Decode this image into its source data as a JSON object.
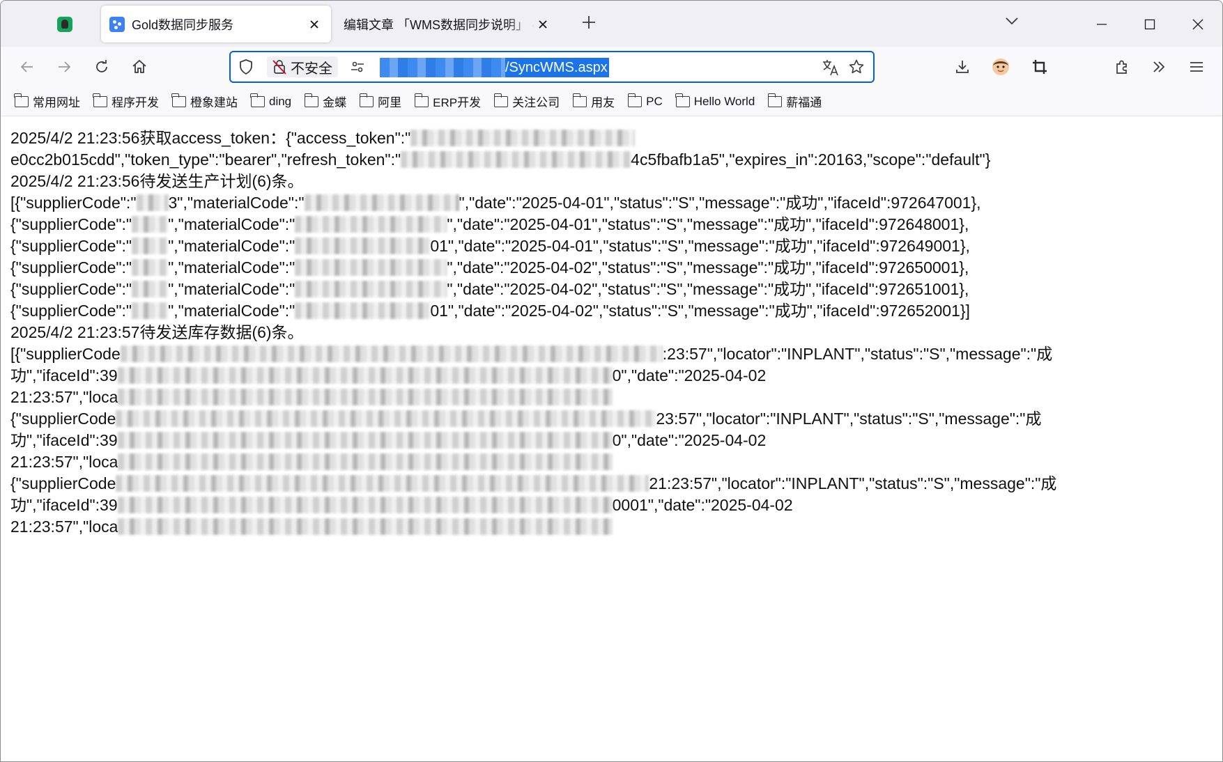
{
  "tabs": [
    {
      "title": "Gold数据同步服务",
      "active": true
    },
    {
      "title": "编辑文章 「WMS数据同步说明」 ‹ s",
      "active": false
    }
  ],
  "urlbar": {
    "security_label": "不安全",
    "url_path": "/SyncWMS.aspx"
  },
  "bookmarks": [
    "常用网址",
    "程序开发",
    "橙象建站",
    "ding",
    "金蝶",
    "阿里",
    "ERP开发",
    "关注公司",
    "用友",
    "PC",
    "Hello World",
    "薪福通"
  ],
  "icons": {
    "pinned_tab": "evernote-icon",
    "tab_favicon": "gold-favicon",
    "nav": [
      "back-icon",
      "forward-icon",
      "reload-icon",
      "home-icon"
    ],
    "urlbar": [
      "shield-icon",
      "insecure-lock-icon",
      "permissions-icon",
      "translate-icon",
      "bookmark-star-icon"
    ],
    "toolbar": [
      "download-icon",
      "profile-avatar-icon",
      "screenshot-crop-icon",
      "extensions-icon",
      "overflow-chevron-icon",
      "menu-icon"
    ],
    "window": [
      "minimize-icon",
      "maximize-icon",
      "close-icon"
    ]
  },
  "log": {
    "l1a": "2025/4/2 21:23:56获取access_token：{\"access_token\":\"",
    "l2a": "e0cc2b015cdd\",\"token_type\":\"bearer\",\"refresh_token\":\"",
    "l2b": "4c5fbafb1a5\",\"expires_in\":20163,\"scope\":\"default\"}",
    "l3": "2025/4/2 21:23:56待发送生产计划(6)条。",
    "l4a": "[{\"supplierCode\":\"",
    "l4b": "3\",\"materialCode\":\"",
    "l4c": "\",\"date\":\"2025-04-01\",\"status\":\"S\",\"message\":\"成功\",\"ifaceId\":972647001},",
    "l5a": "{\"supplierCode\":\"",
    "l5b": "\",\"materialCode\":\"",
    "l5c": "\",\"date\":\"2025-04-01\",\"status\":\"S\",\"message\":\"成功\",\"ifaceId\":972648001},",
    "l6a": "{\"supplierCode\":\"",
    "l6b": "\",\"materialCode\":\"",
    "l6c": "01\",\"date\":\"2025-04-01\",\"status\":\"S\",\"message\":\"成功\",\"ifaceId\":972649001},",
    "l7a": "{\"supplierCode\":\"",
    "l7b": "\",\"materialCode\":\"",
    "l7c": "\",\"date\":\"2025-04-02\",\"status\":\"S\",\"message\":\"成功\",\"ifaceId\":972650001},",
    "l8a": "{\"supplierCode\":\"",
    "l8b": "\",\"materialCode\":\"",
    "l8c": "\",\"date\":\"2025-04-02\",\"status\":\"S\",\"message\":\"成功\",\"ifaceId\":972651001},",
    "l9a": "{\"supplierCode\":\"",
    "l9b": "\",\"materialCode\":\"",
    "l9c": "01\",\"date\":\"2025-04-02\",\"status\":\"S\",\"message\":\"成功\",\"ifaceId\":972652001}]",
    "l10": "2025/4/2 21:23:57待发送库存数据(6)条。",
    "l11a": "[{\"supplierCode",
    "l11b": ":23:57\",\"locator\":\"INPLANT\",\"status\":\"S\",\"message\":\"成",
    "l12a": "功\",\"ifaceId\":39",
    "l12b": "0\",\"date\":\"2025-04-02",
    "l13a": "21:23:57\",\"loca",
    "l14a": "{\"supplierCode",
    "l14b": "23:57\",\"locator\":\"INPLANT\",\"status\":\"S\",\"message\":\"成",
    "l15a": "功\",\"ifaceId\":39",
    "l15b": "0\",\"date\":\"2025-04-02",
    "l16a": "21:23:57\",\"loca",
    "l17a": "{\"supplierCode",
    "l17b": "21:23:57\",\"locator\":\"INPLANT\",\"status\":\"S\",\"message\":\"成",
    "l18a": "功\",\"ifaceId\":39",
    "l18b": "0001\",\"date\":\"2025-04-02",
    "l19a": "21:23:57\",\"loca"
  }
}
